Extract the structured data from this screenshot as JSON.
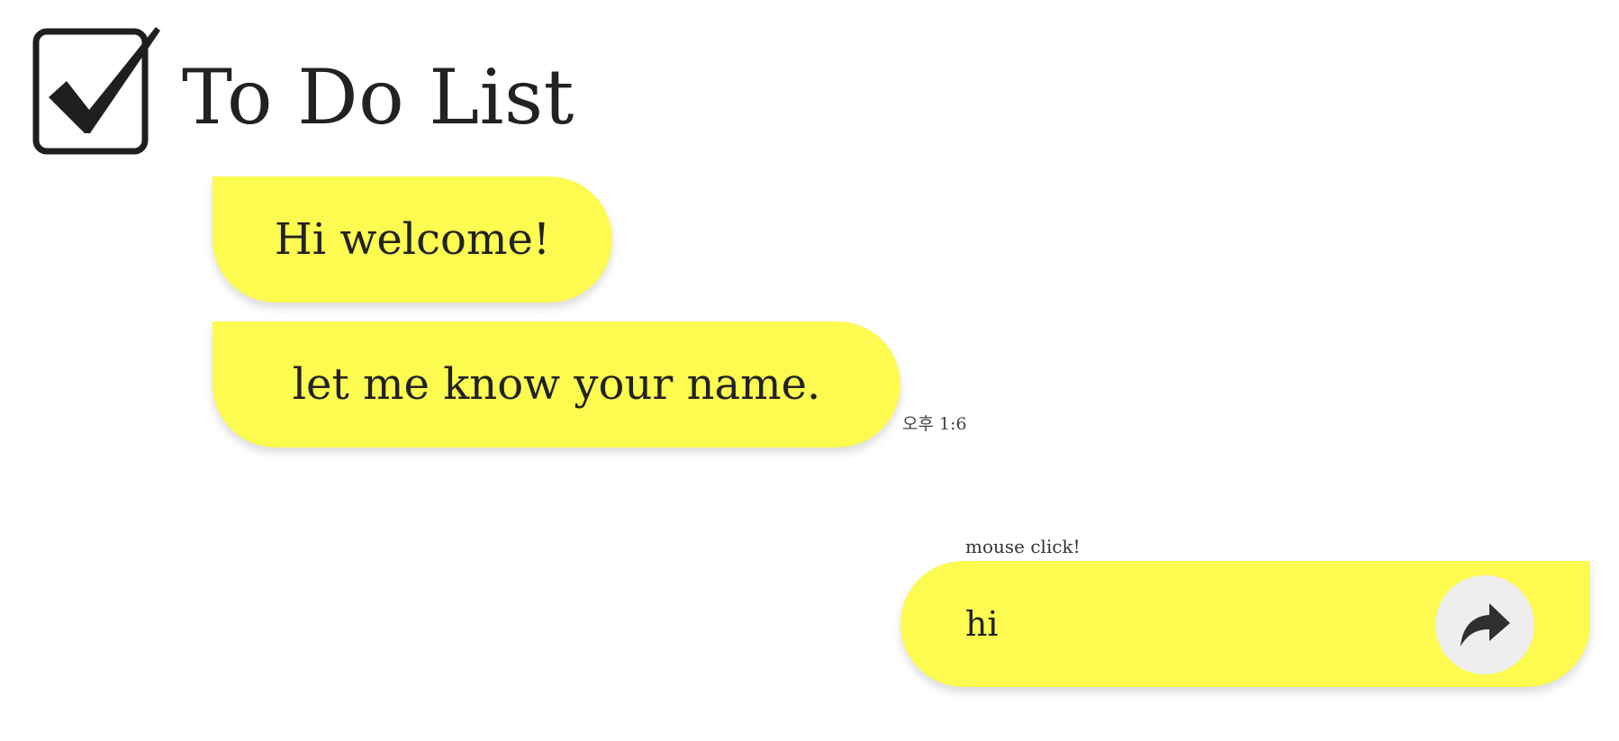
{
  "header": {
    "title": "To Do List",
    "logo_icon": "checkbox-check-icon"
  },
  "messages": [
    {
      "text": "Hi welcome!"
    },
    {
      "text": "let me know your name."
    }
  ],
  "timestamp": "오후 1:6",
  "input_area": {
    "hint": "mouse click!",
    "value": "hi",
    "send_icon": "share-arrow-icon"
  },
  "colors": {
    "bubble": "#fdfa50",
    "send_button_bg": "#eeeeee",
    "text": "#222222"
  }
}
